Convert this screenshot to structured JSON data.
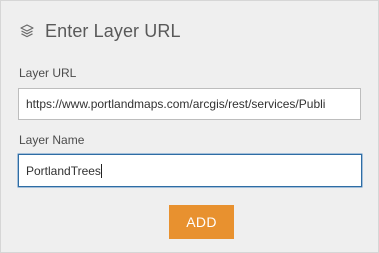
{
  "header": {
    "icon": "layers-icon",
    "title": "Enter Layer URL"
  },
  "form": {
    "url_label": "Layer URL",
    "url_value": "https://www.portlandmaps.com/arcgis/rest/services/Publi",
    "name_label": "Layer Name",
    "name_value": "PortlandTrees",
    "add_label": "ADD"
  },
  "colors": {
    "accent": "#e8912f",
    "panel_bg": "#efefef",
    "focus_border": "#2e6da4"
  }
}
